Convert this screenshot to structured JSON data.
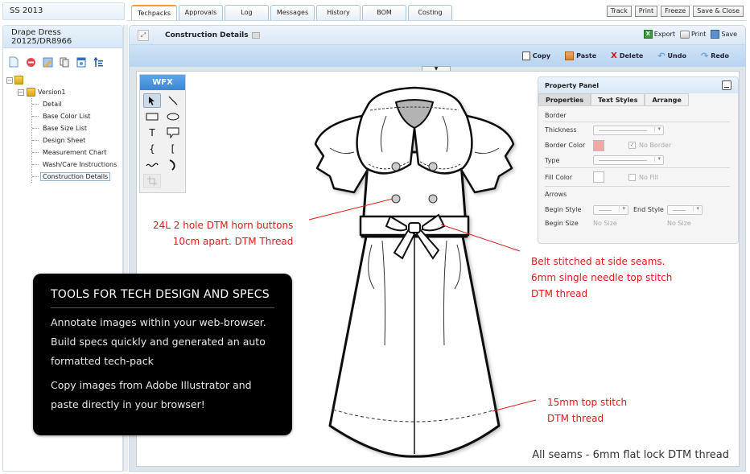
{
  "season": "SS 2013",
  "style": {
    "name": "Drape Dress",
    "code": "20125/DR8966"
  },
  "left_toolbar": [
    {
      "icon": "new-document-icon"
    },
    {
      "icon": "delete-icon"
    },
    {
      "icon": "edit-icon"
    },
    {
      "icon": "copy-icon"
    },
    {
      "icon": "calendar-icon"
    },
    {
      "icon": "hierarchy-icon"
    }
  ],
  "tree": {
    "version_label": "Version1",
    "items": [
      {
        "label": "Detail",
        "selected": false
      },
      {
        "label": "Base Color List",
        "selected": false
      },
      {
        "label": "Base Size List",
        "selected": false
      },
      {
        "label": "Design Sheet",
        "selected": false
      },
      {
        "label": "Measurement Chart",
        "selected": false
      },
      {
        "label": "Wash/Care Instructions",
        "selected": false
      },
      {
        "label": "Construction Details",
        "selected": true
      }
    ]
  },
  "tabs": [
    {
      "label": "Techpacks",
      "active": true
    },
    {
      "label": "Approvals",
      "active": false
    },
    {
      "label": "Log",
      "active": false
    },
    {
      "label": "Messages",
      "active": false
    },
    {
      "label": "History",
      "active": false
    },
    {
      "label": "BOM",
      "active": false
    },
    {
      "label": "Costing",
      "active": false
    }
  ],
  "top_buttons": [
    "Track",
    "Print",
    "Freeze",
    "Save & Close"
  ],
  "main": {
    "title": "Construction Details",
    "head_actions": {
      "export": "Export",
      "print": "Print",
      "save": "Save"
    },
    "edit_actions": {
      "copy": "Copy",
      "paste": "Paste",
      "delete": "Delete",
      "undo": "Undo",
      "redo": "Redo"
    }
  },
  "toolbox": {
    "title": "WFX",
    "tools": [
      {
        "name": "select-tool",
        "glyph": "↖",
        "active": true
      },
      {
        "name": "line-tool",
        "glyph": "╲"
      },
      {
        "name": "rectangle-tool",
        "glyph": "▭"
      },
      {
        "name": "ellipse-tool",
        "glyph": "⬭"
      },
      {
        "name": "text-tool",
        "glyph": "T"
      },
      {
        "name": "callout-tool",
        "glyph": "🗨"
      },
      {
        "name": "curly-brace-tool",
        "glyph": "{"
      },
      {
        "name": "square-bracket-tool",
        "glyph": "["
      },
      {
        "name": "wave-tool",
        "glyph": "∼"
      },
      {
        "name": "arc-tool",
        "glyph": ")"
      },
      {
        "name": "crop-tool",
        "glyph": "⌗",
        "disabled": true
      }
    ]
  },
  "annotations": {
    "buttons": [
      "24L 2 hole DTM horn buttons",
      "10cm apart. DTM Thread"
    ],
    "belt": [
      "Belt stitched at side seams.",
      "6mm single needle top stitch",
      "DTM thread"
    ],
    "hem": [
      "15mm top stitch",
      "DTM thread"
    ],
    "footnote": "All seams - 6mm flat lock DTM thread"
  },
  "property_panel": {
    "title": "Property Panel",
    "tabs": [
      "Properties",
      "Text Styles",
      "Arrange"
    ],
    "active_tab": "Properties",
    "border_section": "Border",
    "thickness_label": "Thickness",
    "border_color_label": "Border Color",
    "border_color": "#f4a6a6",
    "no_border_label": "No Border",
    "no_border_checked": true,
    "type_label": "Type",
    "fill_color_label": "Fill Color",
    "fill_color": "#ffffff",
    "no_fill_label": "No Fill",
    "no_fill_checked": false,
    "arrows_section": "Arrows",
    "begin_style_label": "Begin Style",
    "end_style_label": "End Style",
    "begin_size_label": "Begin Size",
    "begin_size_value": "No Size",
    "end_size_value": "No Size"
  },
  "info_box": {
    "title": "TOOLS FOR TECH DESIGN AND SPECS",
    "para1": [
      "Annotate images within your web-browser.",
      "Build specs quickly and generated an auto",
      "formatted tech-pack"
    ],
    "para2": [
      "Copy images from Adobe Illustrator and",
      "paste directly in your browser!"
    ]
  },
  "colors": {
    "annotation_red": "#e01b1b",
    "active_tab_accent": "#f0a030",
    "wfx_blue": "#3d86d2"
  }
}
